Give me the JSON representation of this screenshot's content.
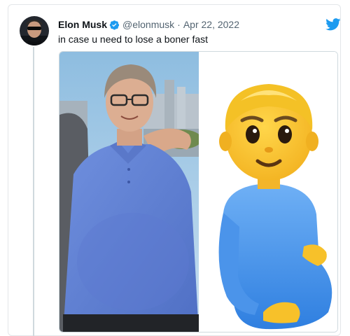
{
  "tweet": {
    "display_name": "Elon Musk",
    "handle": "@elonmusk",
    "separator": "·",
    "date": "Apr 22, 2022",
    "text": "in case u need to lose a boner fast",
    "verified": true
  },
  "icons": {
    "verified": "verified-badge-icon",
    "brand": "twitter-bird-icon"
  },
  "media": {
    "left": "photo-man-blue-polo",
    "right": "pregnant-man-emoji"
  },
  "colors": {
    "brand": "#1d9bf0",
    "name_text": "#0f1419",
    "meta_text": "#536471",
    "border": "#cfd9de"
  }
}
